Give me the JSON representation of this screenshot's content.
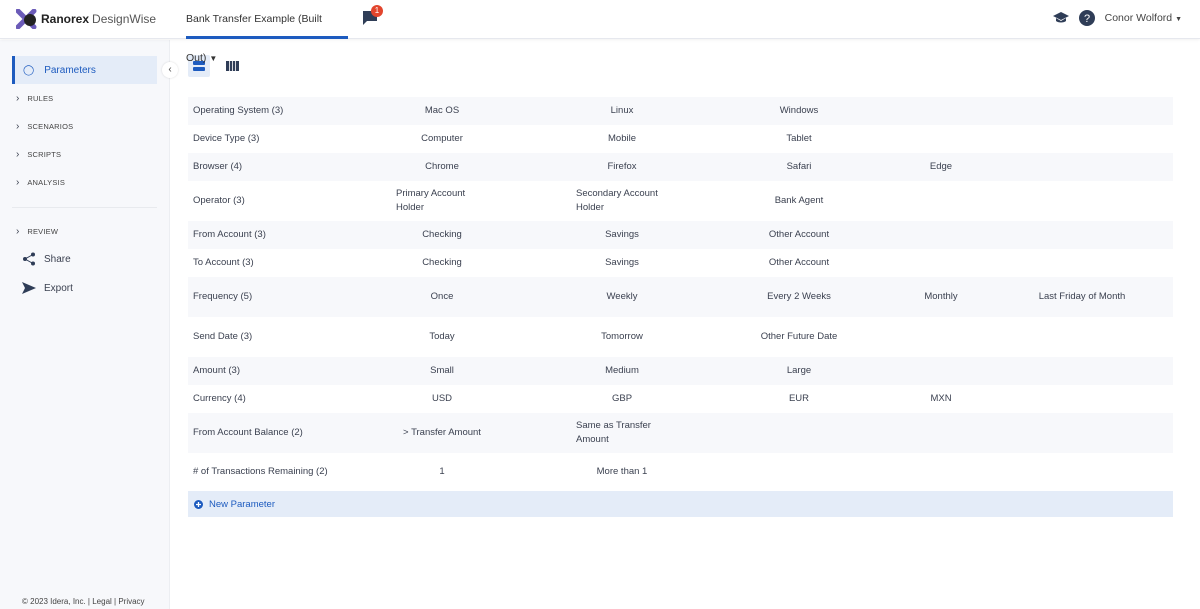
{
  "header": {
    "brand_bold": "Ranorex",
    "brand_light": "DesignWise",
    "project": "Bank Transfer Example (Built Out)",
    "notifications": "1",
    "user": "Conor Wolford"
  },
  "sidebar": {
    "parameters": "Parameters",
    "rules": "RULES",
    "scenarios": "SCENARIOS",
    "scripts": "SCRIPTS",
    "analysis": "ANALYSIS",
    "review": "REVIEW",
    "share": "Share",
    "export": "Export",
    "footer": "© 2023 Idera, Inc. | Legal | Privacy"
  },
  "parameters": [
    {
      "name": "Operating System (3)",
      "values": [
        "Mac OS",
        "Linux",
        "Windows"
      ]
    },
    {
      "name": "Device Type (3)",
      "values": [
        "Computer",
        "Mobile",
        "Tablet"
      ]
    },
    {
      "name": "Browser (4)",
      "values": [
        "Chrome",
        "Firefox",
        "Safari",
        "Edge"
      ]
    },
    {
      "name": "Operator (3)",
      "values": [
        "Primary Account Holder",
        "Secondary Account Holder",
        "Bank Agent"
      ]
    },
    {
      "name": "From Account (3)",
      "values": [
        "Checking",
        "Savings",
        "Other Account"
      ]
    },
    {
      "name": "To Account (3)",
      "values": [
        "Checking",
        "Savings",
        "Other Account"
      ]
    },
    {
      "name": "Frequency (5)",
      "values": [
        "Once",
        "Weekly",
        "Every 2 Weeks",
        "Monthly",
        "Last Friday of Month"
      ]
    },
    {
      "name": "Send Date (3)",
      "values": [
        "Today",
        "Tomorrow",
        "Other Future Date"
      ]
    },
    {
      "name": "Amount (3)",
      "values": [
        "Small",
        "Medium",
        "Large"
      ]
    },
    {
      "name": "Currency (4)",
      "values": [
        "USD",
        "GBP",
        "EUR",
        "MXN"
      ]
    },
    {
      "name": "From Account Balance (2)",
      "values": [
        "> Transfer Amount",
        "Same as Transfer Amount"
      ]
    },
    {
      "name": "# of Transactions Remaining (2)",
      "values": [
        "1",
        "More than 1"
      ]
    }
  ],
  "new_parameter": "New Parameter",
  "colors": {
    "accent": "#1d5bbf",
    "badge": "#e2452d"
  }
}
